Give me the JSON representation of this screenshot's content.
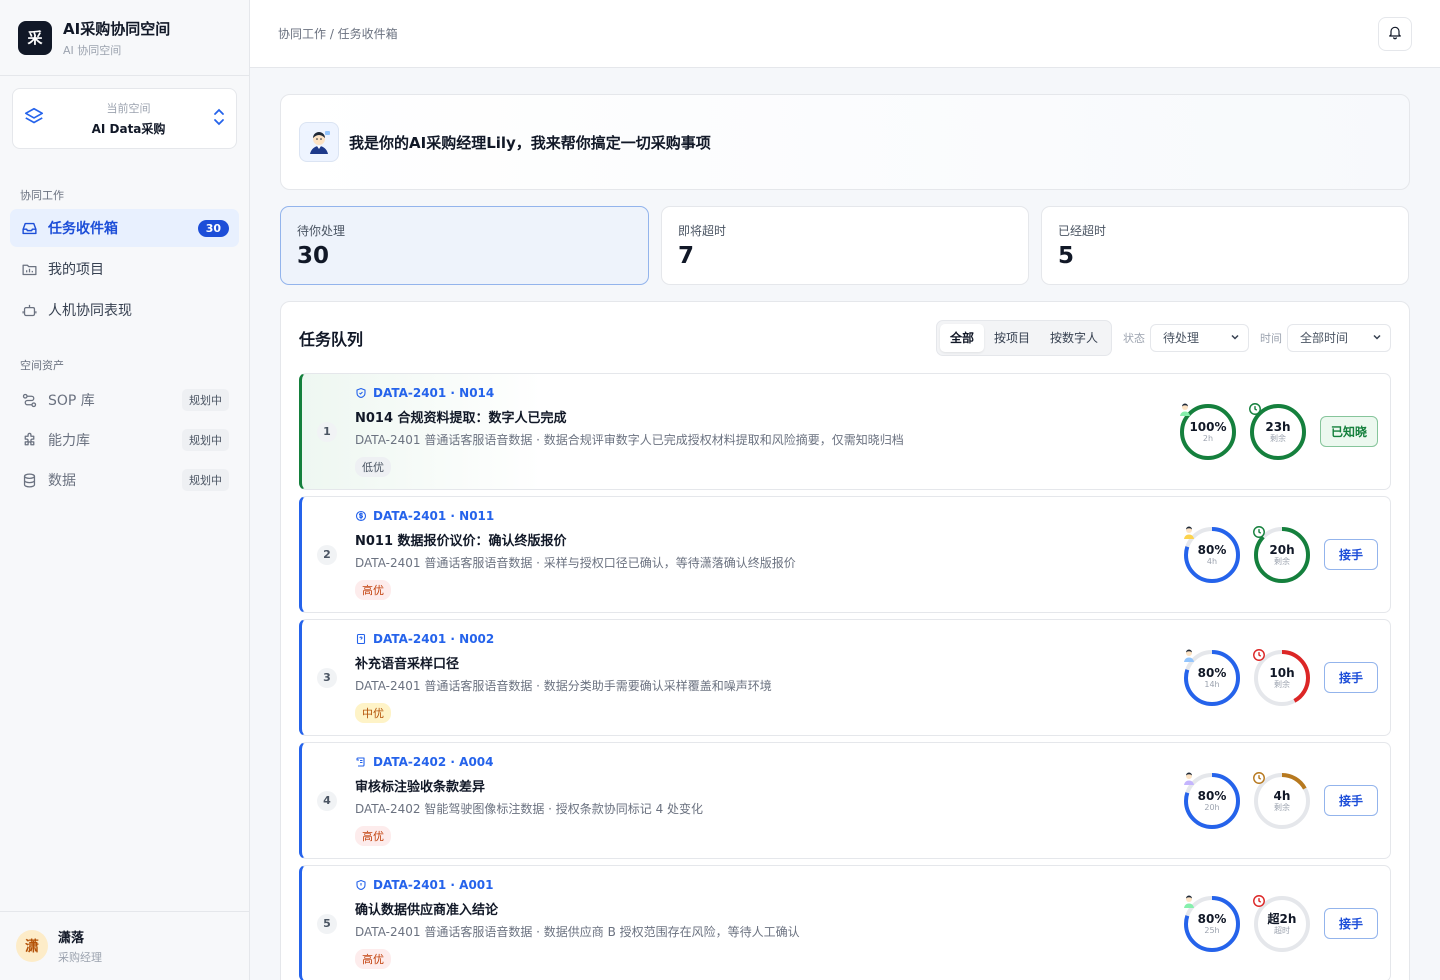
{
  "brand": {
    "logo_char": "采",
    "title": "AI采购协同空间",
    "subtitle": "AI 协同空间"
  },
  "space": {
    "label": "当前空间",
    "name": "AI Data采购"
  },
  "nav": {
    "section1": "协同工作",
    "items1": [
      {
        "label": "任务收件箱",
        "badge": "30",
        "icon": "inbox-icon"
      },
      {
        "label": "我的项目",
        "icon": "folder-icon"
      },
      {
        "label": "人机协同表现",
        "icon": "robot-icon"
      }
    ],
    "section2": "空间资产",
    "items2": [
      {
        "label": "SOP 库",
        "tag": "规划中",
        "icon": "workflow-icon"
      },
      {
        "label": "能力库",
        "tag": "规划中",
        "icon": "puzzle-icon"
      },
      {
        "label": "数据",
        "tag": "规划中",
        "icon": "database-icon"
      }
    ]
  },
  "user": {
    "avatar_char": "潇",
    "name": "潇落",
    "role": "采购经理"
  },
  "topbar": {
    "breadcrumb": "协同工作 / 任务收件箱"
  },
  "hero": {
    "text": "我是你的AI采购经理Lily，我来帮你搞定一切采购事项"
  },
  "stats": [
    {
      "label": "待你处理",
      "value": "30"
    },
    {
      "label": "即将超时",
      "value": "7"
    },
    {
      "label": "已经超时",
      "value": "5"
    }
  ],
  "queue": {
    "title": "任务队列",
    "segments": [
      "全部",
      "按项目",
      "按数字人"
    ],
    "status_label": "状态",
    "status_value": "待处理",
    "time_label": "时间",
    "time_value": "全部时间"
  },
  "colors": {
    "blue": "#2563eb",
    "green": "#15803d",
    "red": "#dc2626",
    "amber": "#b7791f",
    "track": "#e5e7eb"
  },
  "tasks": [
    {
      "index": "1",
      "code": "DATA-2401 · N014",
      "code_icon": "shield-icon",
      "title": "N014 合规资料提取：数字人已完成",
      "desc": "DATA-2401 普通话客服语音数据 · 数据合规评审数字人已完成授权材料提取和风险摘要，仅需知晓归档",
      "priority": "低优",
      "priority_level": "low",
      "progress": 100,
      "progress_text": "100%",
      "progress_sub": "2h",
      "progress_color": "green",
      "time_main": "23h",
      "time_sub": "剩余",
      "time_fraction": 1.0,
      "time_color": "green",
      "action": "已知晓",
      "action_state": "done",
      "highlight": true
    },
    {
      "index": "2",
      "code": "DATA-2401 · N011",
      "code_icon": "dollar-icon",
      "title": "N011 数据报价议价：确认终版报价",
      "desc": "DATA-2401 普通话客服语音数据 · 采样与授权口径已确认，等待潇落确认终版报价",
      "priority": "高优",
      "priority_level": "high",
      "progress": 80,
      "progress_text": "80%",
      "progress_sub": "4h",
      "progress_color": "blue",
      "time_main": "20h",
      "time_sub": "剩余",
      "time_fraction": 0.87,
      "time_color": "green",
      "action": "接手",
      "action_state": "todo",
      "highlight": false
    },
    {
      "index": "3",
      "code": "DATA-2401 · N002",
      "code_icon": "question-doc-icon",
      "title": "补充语音采样口径",
      "desc": "DATA-2401 普通话客服语音数据 · 数据分类助手需要确认采样覆盖和噪声环境",
      "priority": "中优",
      "priority_level": "mid",
      "progress": 80,
      "progress_text": "80%",
      "progress_sub": "14h",
      "progress_color": "blue",
      "time_main": "10h",
      "time_sub": "剩余",
      "time_fraction": 0.42,
      "time_color": "red",
      "action": "接手",
      "action_state": "todo",
      "highlight": false
    },
    {
      "index": "4",
      "code": "DATA-2402 · A004",
      "code_icon": "scroll-icon",
      "title": "审核标注验收条款差异",
      "desc": "DATA-2402 智能驾驶图像标注数据 · 授权条款协同标记 4 处变化",
      "priority": "高优",
      "priority_level": "high",
      "progress": 80,
      "progress_text": "80%",
      "progress_sub": "20h",
      "progress_color": "blue",
      "time_main": "4h",
      "time_sub": "剩余",
      "time_fraction": 0.17,
      "time_color": "amber",
      "action": "接手",
      "action_state": "todo",
      "highlight": false
    },
    {
      "index": "5",
      "code": "DATA-2401 · A001",
      "code_icon": "shield-alert-icon",
      "title": "确认数据供应商准入结论",
      "desc": "DATA-2401 普通话客服语音数据 · 数据供应商 B 授权范围存在风险，等待人工确认",
      "priority": "高优",
      "priority_level": "high",
      "progress": 80,
      "progress_text": "80%",
      "progress_sub": "25h",
      "progress_color": "blue",
      "time_main": "超2h",
      "time_sub": "超时",
      "time_fraction": 0.0,
      "time_color": "red",
      "action": "接手",
      "action_state": "todo",
      "highlight": false
    }
  ]
}
